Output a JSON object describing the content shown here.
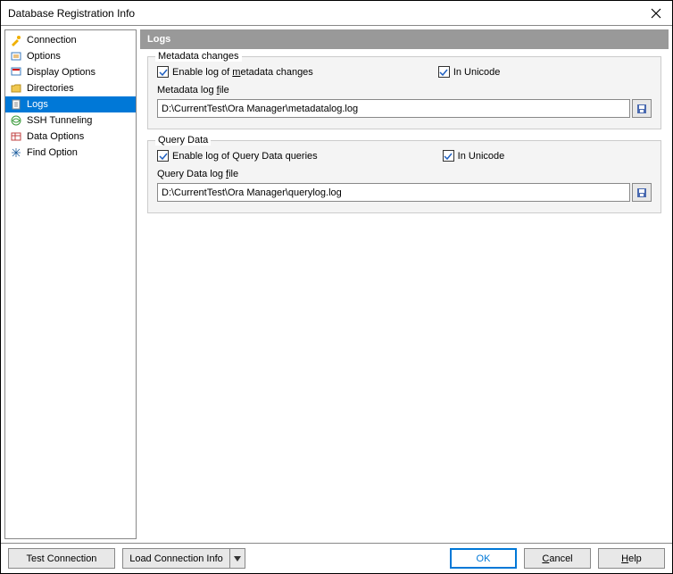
{
  "window": {
    "title": "Database Registration Info"
  },
  "sidebar": {
    "items": [
      {
        "label": "Connection",
        "selected": false,
        "icon": "connection"
      },
      {
        "label": "Options",
        "selected": false,
        "icon": "options"
      },
      {
        "label": "Display Options",
        "selected": false,
        "icon": "display"
      },
      {
        "label": "Directories",
        "selected": false,
        "icon": "directories"
      },
      {
        "label": "Logs",
        "selected": true,
        "icon": "logs"
      },
      {
        "label": "SSH Tunneling",
        "selected": false,
        "icon": "ssh"
      },
      {
        "label": "Data Options",
        "selected": false,
        "icon": "data"
      },
      {
        "label": "Find Option",
        "selected": false,
        "icon": "find"
      }
    ]
  },
  "content": {
    "title": "Logs",
    "groups": {
      "metadata": {
        "title": "Metadata changes",
        "enable_label_pre": "Enable log of ",
        "enable_label_u": "m",
        "enable_label_post": "etadata changes",
        "enable_checked": true,
        "unicode_label": "In Unicode",
        "unicode_checked": true,
        "file_label_pre": "Metadata log ",
        "file_label_u": "f",
        "file_label_post": "ile",
        "file_value": "D:\\CurrentTest\\Ora Manager\\metadatalog.log"
      },
      "query": {
        "title": "Query Data",
        "enable_label": "Enable log of Query Data queries",
        "enable_checked": true,
        "unicode_label": "In Unicode",
        "unicode_checked": true,
        "file_label_pre": "Query Data log ",
        "file_label_u": "f",
        "file_label_post": "ile",
        "file_value": "D:\\CurrentTest\\Ora Manager\\querylog.log"
      }
    }
  },
  "footer": {
    "test": "Test Connection",
    "load": "Load Connection Info",
    "ok": "OK",
    "cancel_u": "C",
    "cancel_post": "ancel",
    "help_u": "H",
    "help_post": "elp"
  }
}
